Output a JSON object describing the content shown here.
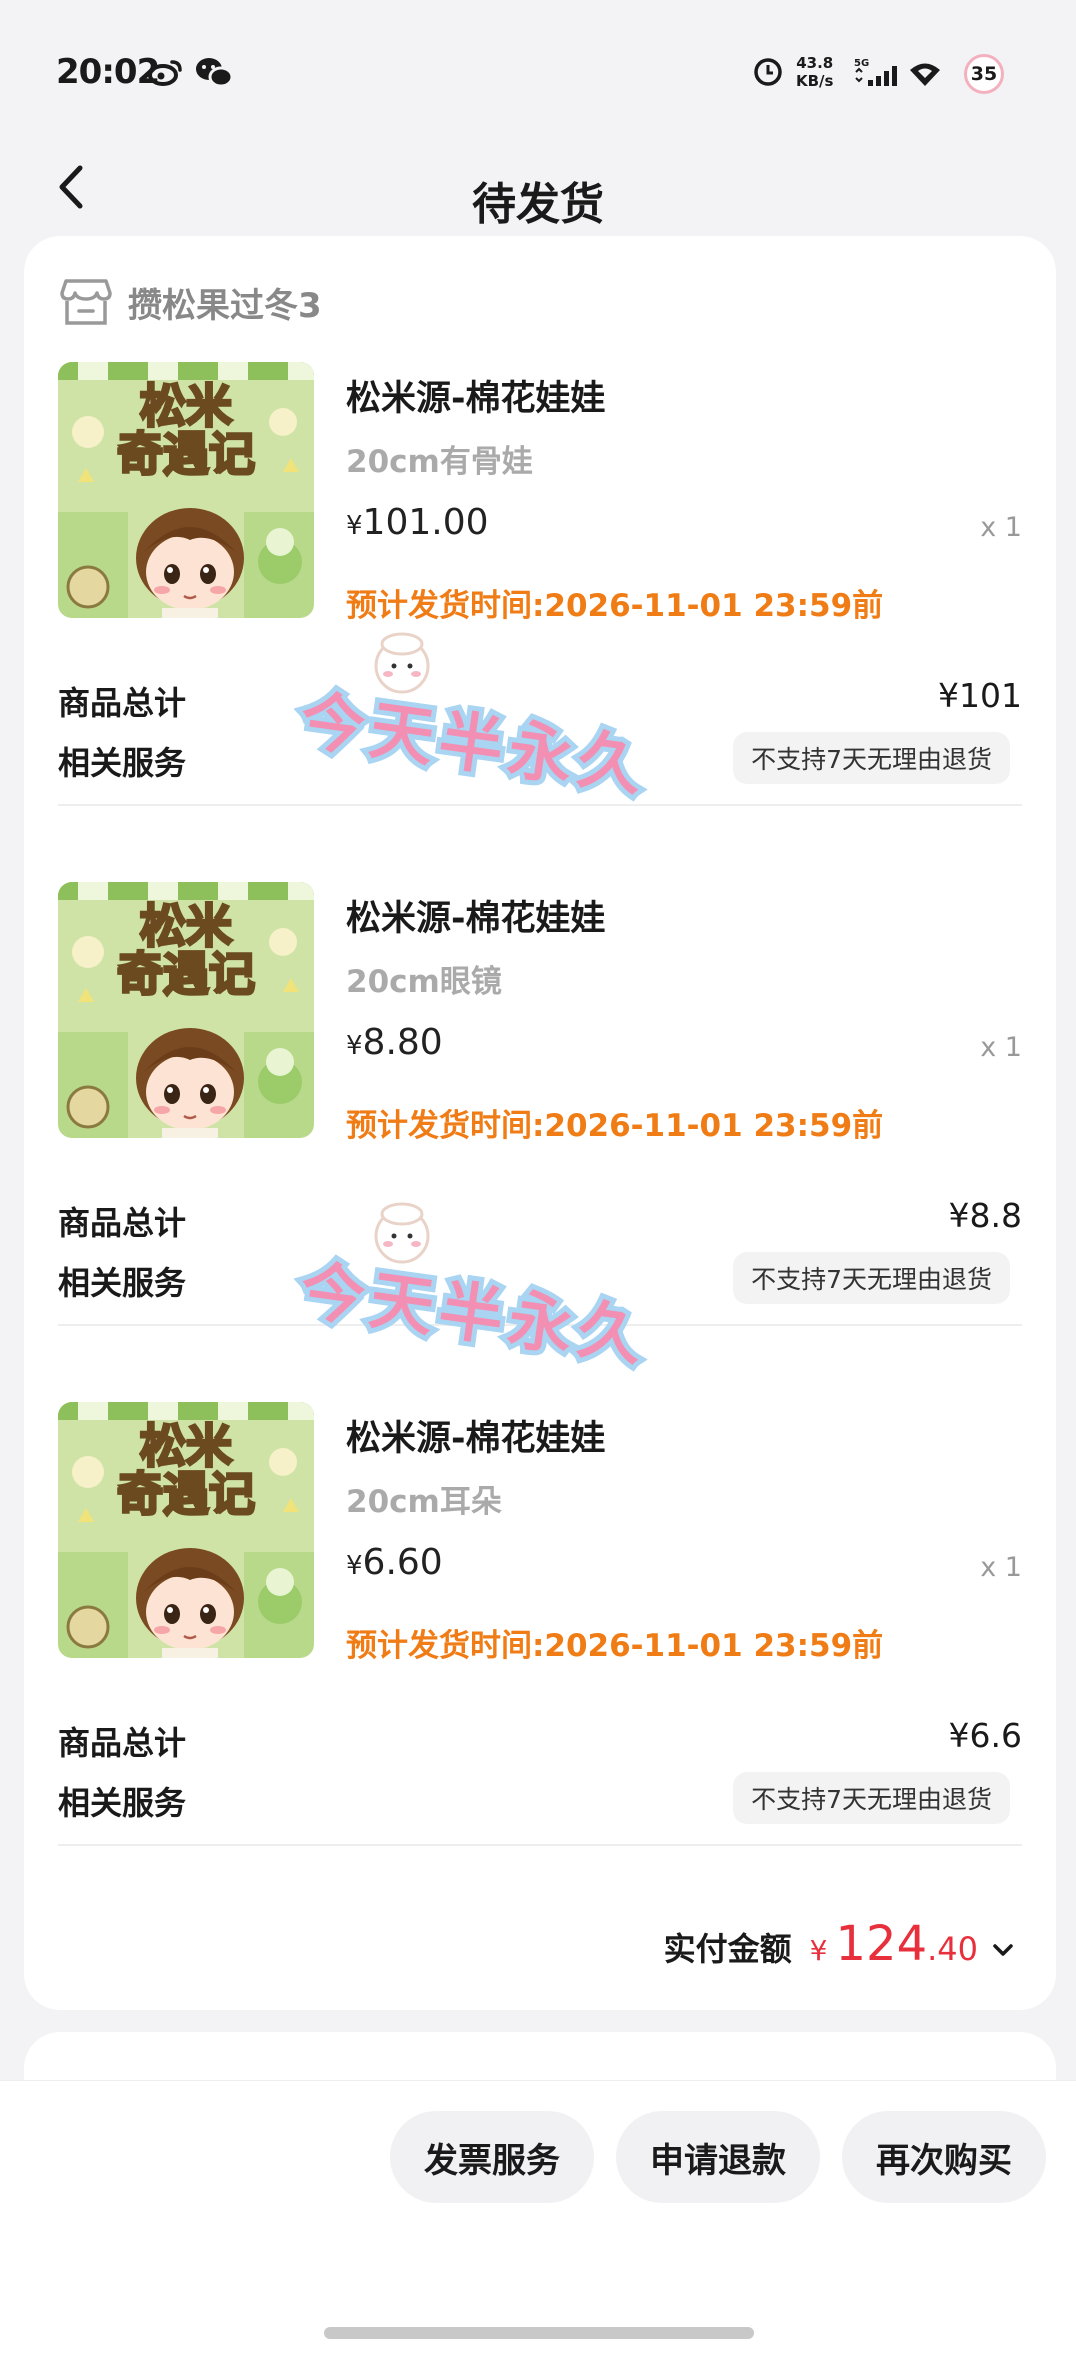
{
  "status_bar": {
    "time": "20:02",
    "net_speed_value": "43.8",
    "net_speed_unit": "KB/s",
    "network": "5G",
    "battery": "35",
    "icons": [
      "weibo-icon",
      "wechat-icon",
      "clock-icon",
      "signal-icon",
      "wifi-icon"
    ]
  },
  "header": {
    "title": "待发货",
    "back_icon": "chevron-left-icon"
  },
  "shop": {
    "name": "攒松果过冬3",
    "icon": "shop-icon"
  },
  "items": [
    {
      "name": "松米源-棉花娃娃",
      "variant": "20cm有骨娃",
      "price_symbol": "¥",
      "price": "101.00",
      "qty": "x 1",
      "ship_time": "预计发货时间:2026-11-01 23:59前",
      "total_label": "商品总计",
      "total_value": "¥101",
      "service_label": "相关服务",
      "service_tag": "不支持7天无理由退货"
    },
    {
      "name": "松米源-棉花娃娃",
      "variant": "20cm眼镜",
      "price_symbol": "¥",
      "price": "8.80",
      "qty": "x 1",
      "ship_time": "预计发货时间:2026-11-01 23:59前",
      "total_label": "商品总计",
      "total_value": "¥8.8",
      "service_label": "相关服务",
      "service_tag": "不支持7天无理由退货"
    },
    {
      "name": "松米源-棉花娃娃",
      "variant": "20cm耳朵",
      "price_symbol": "¥",
      "price": "6.60",
      "qty": "x 1",
      "ship_time": "预计发货时间:2026-11-01 23:59前",
      "total_label": "商品总计",
      "total_value": "¥6.6",
      "service_label": "相关服务",
      "service_tag": "不支持7天无理由退货"
    }
  ],
  "thumbnail_text": {
    "line1": "松米",
    "line2": "奇遇记"
  },
  "watermark_text": "今天半永久",
  "paid": {
    "label": "实付金额",
    "symbol": "¥",
    "integer": "124",
    "decimal": ".40"
  },
  "actions": {
    "invoice": "发票服务",
    "refund": "申请退款",
    "rebuy": "再次购买"
  },
  "colors": {
    "accent_orange": "#f07c16",
    "price_red": "#e8303c",
    "background": "#f3f3f5"
  }
}
